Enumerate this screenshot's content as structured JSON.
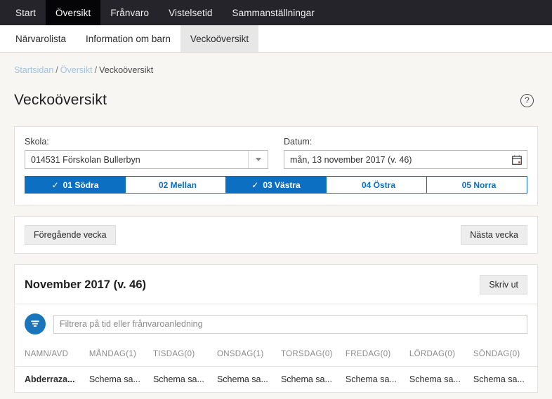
{
  "topnav": {
    "items": [
      {
        "label": "Start",
        "active": false
      },
      {
        "label": "Översikt",
        "active": true
      },
      {
        "label": "Frånvaro",
        "active": false
      },
      {
        "label": "Vistelsetid",
        "active": false
      },
      {
        "label": "Sammanställningar",
        "active": false
      }
    ]
  },
  "subtabs": {
    "items": [
      {
        "label": "Närvarolista",
        "active": false
      },
      {
        "label": "Information om barn",
        "active": false
      },
      {
        "label": "Veckoöversikt",
        "active": true
      }
    ]
  },
  "breadcrumb": {
    "home": "Startsidan",
    "parent": "Översikt",
    "current": "Veckoöversikt",
    "separator": "/"
  },
  "header": {
    "title": "Veckoöversikt",
    "help_icon": "question-circle-icon",
    "help_glyph": "?"
  },
  "filters": {
    "school": {
      "label": "Skola:",
      "value": "014531 Förskolan Bullerbyn",
      "dropdown_icon": "chevron-down-icon"
    },
    "date": {
      "label": "Datum:",
      "value": "mån, 13 november 2017 (v. 46)",
      "calendar_icon": "calendar-icon"
    },
    "departments": [
      {
        "label": "01 Södra",
        "selected": true,
        "check": "✓"
      },
      {
        "label": "02 Mellan",
        "selected": false,
        "check": ""
      },
      {
        "label": "03 Västra",
        "selected": true,
        "check": "✓"
      },
      {
        "label": "04 Östra",
        "selected": false,
        "check": ""
      },
      {
        "label": "05 Norra",
        "selected": false,
        "check": ""
      }
    ],
    "accent_color": "#0c6fc2"
  },
  "weeknav": {
    "prev_label": "Föregående vecka",
    "next_label": "Nästa vecka"
  },
  "results": {
    "title": "November 2017 (v. 46)",
    "print_label": "Skriv ut",
    "filter_icon": "funnel-icon",
    "filter_icon_color": "#1b75bb",
    "filter_placeholder": "Filtrera på tid eller frånvaroanledning",
    "filter_value": "",
    "table": {
      "columns": [
        "NAMN/AVD",
        "MÅNDAG(1)",
        "TISDAG(0)",
        "ONSDAG(1)",
        "TORSDAG(0)",
        "FREDAG(0)",
        "LÖRDAG(0)",
        "SÖNDAG(0)"
      ],
      "rows": [
        {
          "name": "Abderraza...",
          "cells": [
            "Schema sa...",
            "Schema sa...",
            "Schema sa...",
            "Schema sa...",
            "Schema sa...",
            "Schema sa...",
            "Schema sa..."
          ]
        }
      ]
    }
  }
}
